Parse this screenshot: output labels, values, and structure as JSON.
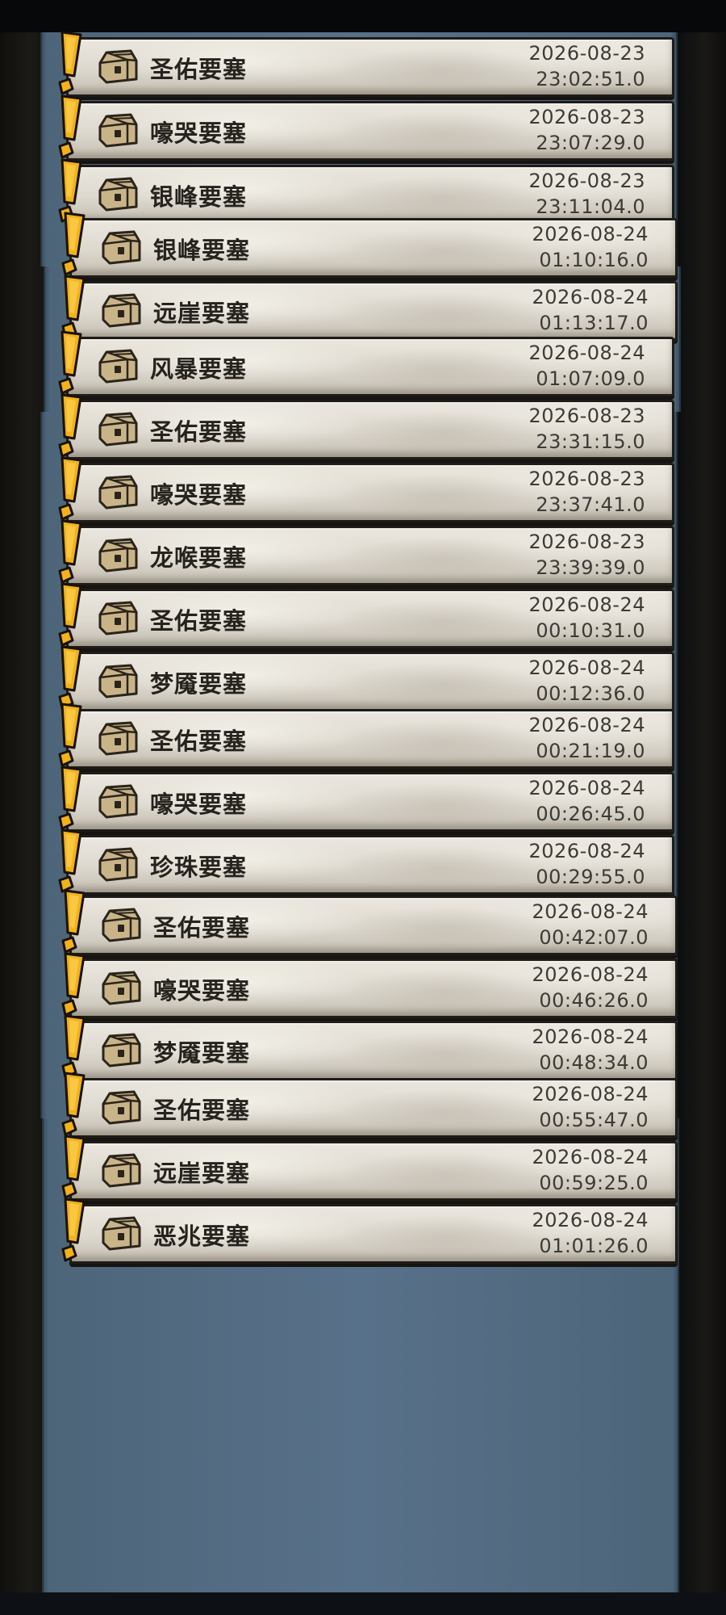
{
  "entries": [
    {
      "name": "圣佑要塞",
      "date": "2026-08-23",
      "time": "23:02:51.0"
    },
    {
      "name": "嚎哭要塞",
      "date": "2026-08-23",
      "time": "23:07:29.0"
    },
    {
      "name": "银峰要塞",
      "date": "2026-08-23",
      "time": "23:11:04.0"
    },
    {
      "name": "银峰要塞",
      "date": "2026-08-24",
      "time": "01:10:16.0"
    },
    {
      "name": "远崖要塞",
      "date": "2026-08-24",
      "time": "01:13:17.0"
    },
    {
      "name": "风暴要塞",
      "date": "2026-08-24",
      "time": "01:07:09.0"
    },
    {
      "name": "圣佑要塞",
      "date": "2026-08-23",
      "time": "23:31:15.0"
    },
    {
      "name": "嚎哭要塞",
      "date": "2026-08-23",
      "time": "23:37:41.0"
    },
    {
      "name": "龙喉要塞",
      "date": "2026-08-23",
      "time": "23:39:39.0"
    },
    {
      "name": "圣佑要塞",
      "date": "2026-08-24",
      "time": "00:10:31.0"
    },
    {
      "name": "梦魇要塞",
      "date": "2026-08-24",
      "time": "00:12:36.0"
    },
    {
      "name": "圣佑要塞",
      "date": "2026-08-24",
      "time": "00:21:19.0"
    },
    {
      "name": "嚎哭要塞",
      "date": "2026-08-24",
      "time": "00:26:45.0"
    },
    {
      "name": "珍珠要塞",
      "date": "2026-08-24",
      "time": "00:29:55.0"
    },
    {
      "name": "圣佑要塞",
      "date": "2026-08-24",
      "time": "00:42:07.0"
    },
    {
      "name": "嚎哭要塞",
      "date": "2026-08-24",
      "time": "00:46:26.0"
    },
    {
      "name": "梦魇要塞",
      "date": "2026-08-24",
      "time": "00:48:34.0"
    },
    {
      "name": "圣佑要塞",
      "date": "2026-08-24",
      "time": "00:55:47.0"
    },
    {
      "name": "远崖要塞",
      "date": "2026-08-24",
      "time": "00:59:25.0"
    },
    {
      "name": "恶兆要塞",
      "date": "2026-08-24",
      "time": "01:01:26.0"
    }
  ],
  "icons": {
    "alert": "exclamation-icon",
    "chest": "treasure-chest-icon"
  },
  "colors": {
    "alert_fill": "#f2b21c",
    "alert_outline": "#1a1208",
    "chest_fill": "#c9b48a",
    "panel": "#58718a"
  }
}
